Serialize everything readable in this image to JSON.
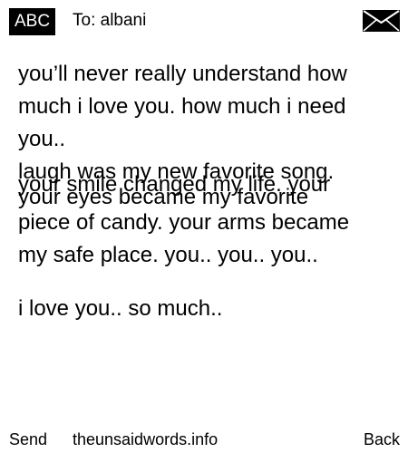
{
  "header": {
    "input_mode": "ABC",
    "to_label": "To: albani",
    "icon": "envelope-icon"
  },
  "message": {
    "line1": "you’ll never really understand how",
    "line2": "much i love you. how much i need",
    "line3": "you..",
    "line4": "laugh was my new favorite song.",
    "line5": "your smile changed my life. your",
    "line6": "your eyes became my favorite",
    "line7": "piece of candy. your arms became",
    "line8": "my safe place. you.. you.. you..",
    "line9": "i love you.. so much.."
  },
  "footer": {
    "send_label": "Send",
    "site_label": "theunsaidwords.info",
    "back_label": "Back"
  }
}
